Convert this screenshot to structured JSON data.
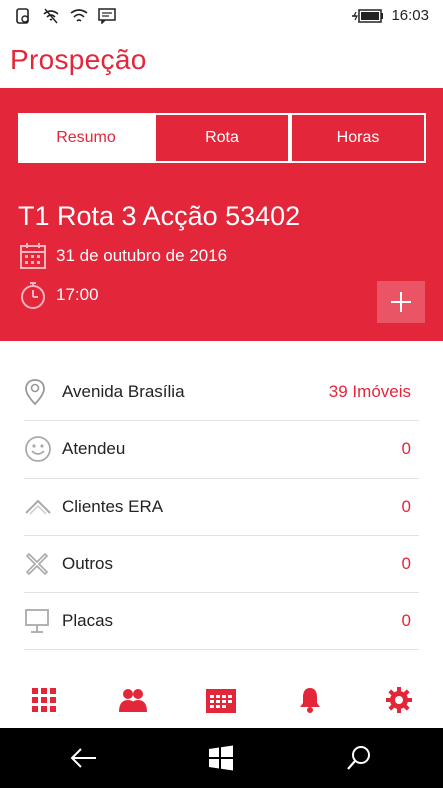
{
  "status_bar": {
    "time": "16:03",
    "icons": [
      "sim-card-icon",
      "wifi-off-icon",
      "wifi-icon",
      "wave-icon",
      "message-icon",
      "battery-charging-icon"
    ]
  },
  "app": {
    "title": "Prospeção",
    "accent_color": "#e3263a"
  },
  "tabs": [
    {
      "label": "Resumo",
      "active": true
    },
    {
      "label": "Rota",
      "active": false
    },
    {
      "label": "Horas",
      "active": false
    }
  ],
  "route": {
    "title": "T1 Rota 3 Acção 53402",
    "date": "31 de outubro de 2016",
    "time": "17:00",
    "add_icon": "plus-icon"
  },
  "list": [
    {
      "icon": "location-pin-icon",
      "label": "Avenida Brasília",
      "value": "39 Imóveis"
    },
    {
      "icon": "smiley-icon",
      "label": "Atendeu",
      "value": "0"
    },
    {
      "icon": "chevron-up-icon",
      "label": "Clientes ERA",
      "value": "0"
    },
    {
      "icon": "x-icon",
      "label": "Outros",
      "value": "0"
    },
    {
      "icon": "sign-icon",
      "label": "Placas",
      "value": "0"
    }
  ],
  "bottom_nav": [
    "grid-icon",
    "people-icon",
    "calendar-icon",
    "bell-icon",
    "gear-icon"
  ],
  "system_bar": [
    "back-icon",
    "windows-icon",
    "search-icon"
  ]
}
